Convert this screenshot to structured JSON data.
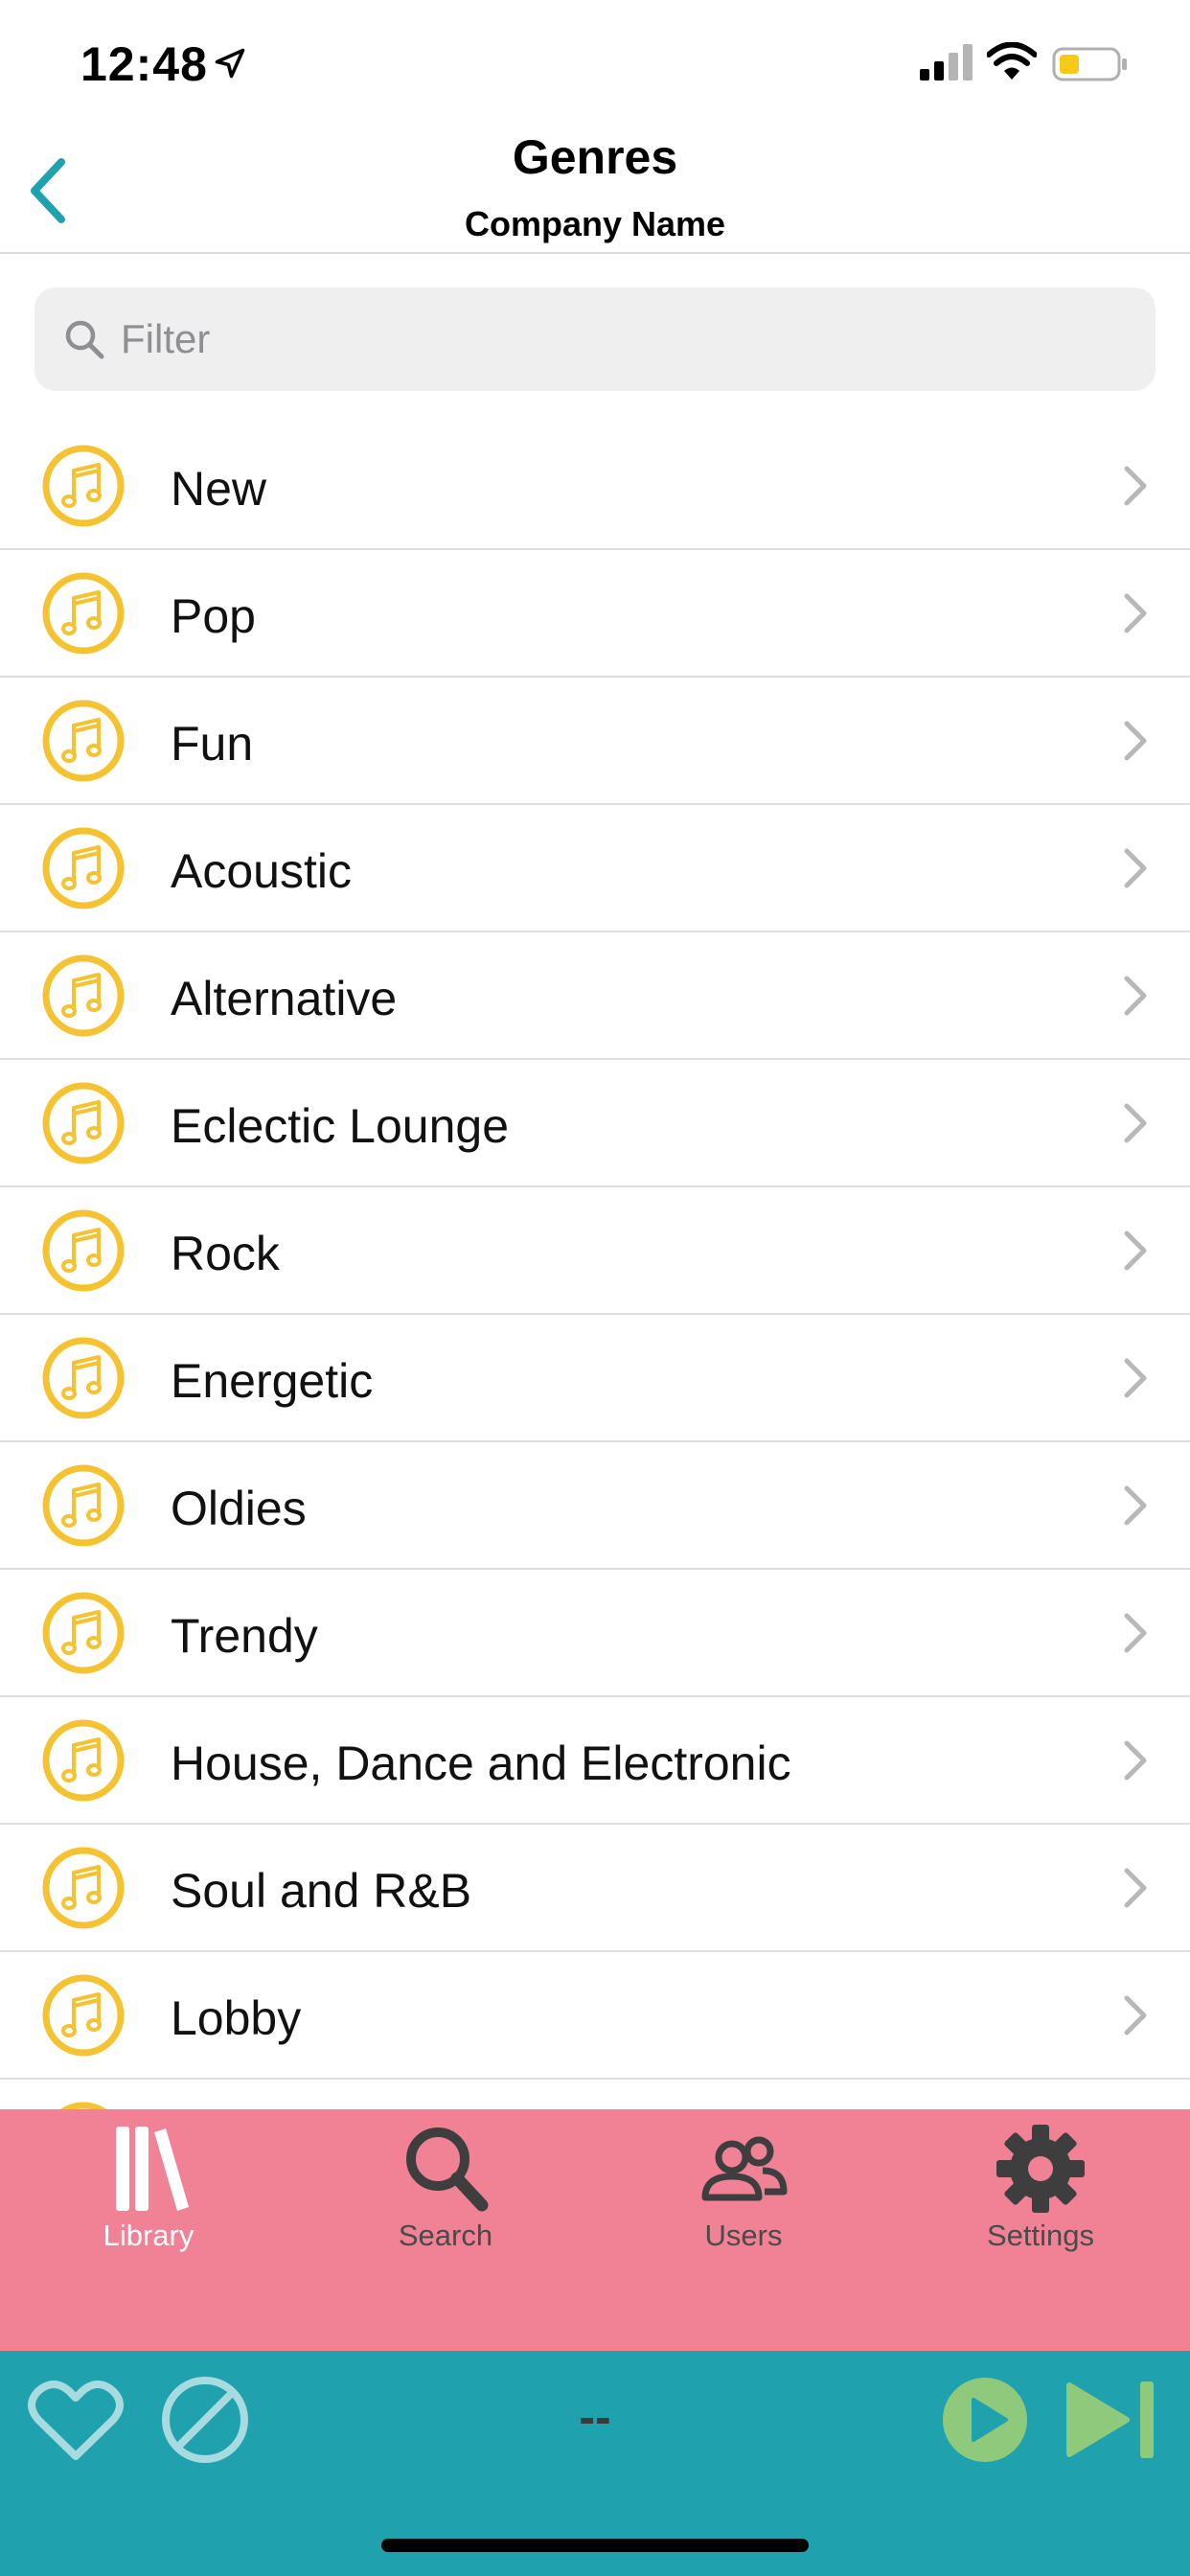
{
  "status_bar": {
    "time": "12:48"
  },
  "header": {
    "title": "Genres",
    "subtitle": "Company Name"
  },
  "filter": {
    "placeholder": "Filter",
    "value": ""
  },
  "genres": [
    {
      "label": "New"
    },
    {
      "label": "Pop"
    },
    {
      "label": "Fun"
    },
    {
      "label": "Acoustic"
    },
    {
      "label": "Alternative"
    },
    {
      "label": "Eclectic Lounge"
    },
    {
      "label": "Rock"
    },
    {
      "label": "Energetic"
    },
    {
      "label": "Oldies"
    },
    {
      "label": "Trendy"
    },
    {
      "label": "House, Dance and Electronic"
    },
    {
      "label": "Soul and R&B"
    },
    {
      "label": "Lobby"
    }
  ],
  "tabs": [
    {
      "label": "Library",
      "icon": "library-icon",
      "active": true
    },
    {
      "label": "Search",
      "icon": "search-icon",
      "active": false
    },
    {
      "label": "Users",
      "icon": "users-icon",
      "active": false
    },
    {
      "label": "Settings",
      "icon": "gear-icon",
      "active": false
    }
  ],
  "player": {
    "now_playing": "--"
  },
  "colors": {
    "accent": "#1fa1ae",
    "icon_yellow": "#f5c331",
    "tab_bar": "#f18296",
    "player_bar": "#1fa1ae",
    "play_green": "#8fc97c"
  }
}
